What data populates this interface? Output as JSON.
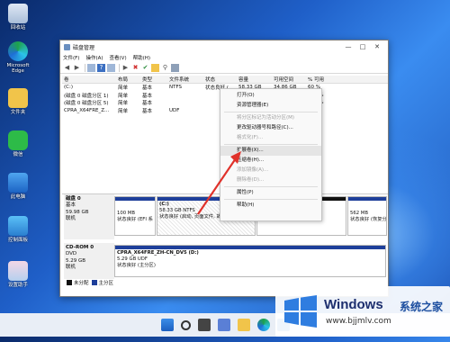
{
  "desktop": {
    "icons": [
      {
        "label": "回收站",
        "icon": "recycle-bin-icon"
      },
      {
        "label": "Microsoft Edge",
        "icon": "edge-icon"
      },
      {
        "label": "文件夹",
        "icon": "folder-icon"
      },
      {
        "label": "微信",
        "icon": "wechat-icon"
      },
      {
        "label": "此电脑",
        "icon": "computer-icon"
      },
      {
        "label": "控制面板",
        "icon": "control-panel-icon"
      },
      {
        "label": "设置助手",
        "icon": "app-icon"
      }
    ]
  },
  "window": {
    "title": "磁盘管理",
    "menus": [
      "文件(F)",
      "操作(A)",
      "查看(V)",
      "帮助(H)"
    ],
    "columns": [
      "卷",
      "布局",
      "类型",
      "文件系统",
      "状态",
      "容量",
      "可用空间",
      "% 可用"
    ],
    "volumes": [
      [
        "(C:)",
        "简单",
        "基本",
        "NTFS",
        "状态良好 (...",
        "58.33 GB",
        "34.86 GB",
        "60 %"
      ],
      [
        "(磁盘 0 磁盘分区 1)",
        "简单",
        "基本",
        "",
        "",
        "",
        "",
        "100 %"
      ],
      [
        "(磁盘 0 磁盘分区 5)",
        "简单",
        "基本",
        "",
        "",
        "",
        "",
        "100 %"
      ],
      [
        "CPRA_X64FRE_Z...",
        "简单",
        "基本",
        "UDF",
        "",
        "",
        "",
        "0 %"
      ]
    ],
    "disk0": {
      "label": "磁盘 0",
      "type": "基本",
      "size": "59.98 GB",
      "status": "联机",
      "segments": [
        {
          "lines": [
            "100 MB",
            "状态良好 (EFI 系"
          ]
        },
        {
          "lines": [
            "(C:)",
            "58.33 GB NTFS",
            "状态良好 (启动, 页面文件, 故障"
          ]
        },
        {
          "lines": [
            "",
            "",
            "未分配"
          ]
        },
        {
          "lines": [
            "562 MB",
            "状态良好 (恢复分区"
          ]
        }
      ]
    },
    "cdrom0": {
      "label": "CD-ROM 0",
      "type": "DVD",
      "size": "5.29 GB",
      "status": "联机",
      "segment": [
        "CPRA_X64FRE_ZH-CN_DV5 (D:)",
        "5.29 GB UDF",
        "状态良好 (主分区)"
      ]
    },
    "legend": [
      "未分配",
      "主分区"
    ]
  },
  "context_menu": {
    "items": [
      {
        "label": "打开(O)",
        "disabled": false
      },
      {
        "label": "资源管理器(E)",
        "disabled": false
      },
      {
        "label": "---"
      },
      {
        "label": "将分区标记为活动分区(M)",
        "disabled": true
      },
      {
        "label": "更改驱动器号和路径(C)...",
        "disabled": false
      },
      {
        "label": "格式化(F)...",
        "disabled": true
      },
      {
        "label": "---"
      },
      {
        "label": "扩展卷(X)...",
        "disabled": false,
        "highlight": true
      },
      {
        "label": "压缩卷(H)...",
        "disabled": false
      },
      {
        "label": "添加镜像(A)...",
        "disabled": true
      },
      {
        "label": "删除卷(D)...",
        "disabled": true
      },
      {
        "label": "---"
      },
      {
        "label": "属性(P)",
        "disabled": false
      },
      {
        "label": "---"
      },
      {
        "label": "帮助(H)",
        "disabled": false
      }
    ]
  },
  "watermark": {
    "brand": "Windows",
    "brand_cn": "系统之家",
    "url": "www.bjjmlv.com"
  },
  "colors": {
    "partition_bar": "#1e3f9a",
    "arrow": "#e0322b",
    "unallocated": "#111111"
  }
}
